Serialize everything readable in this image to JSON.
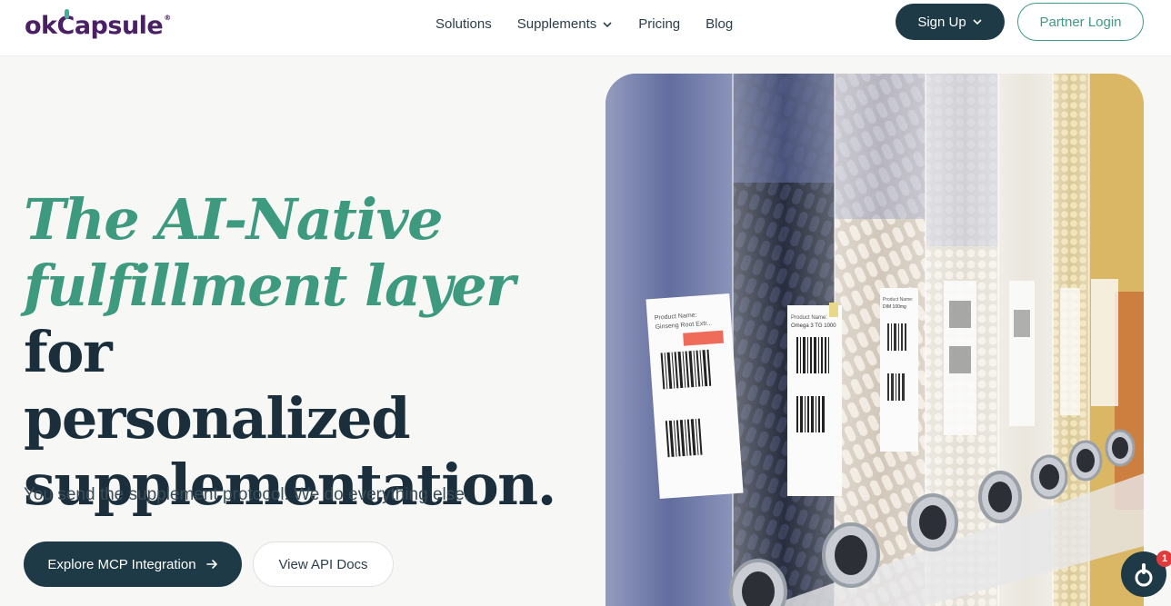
{
  "header": {
    "logo_text": "okCapsule",
    "logo_reg": "®",
    "nav": [
      {
        "label": "Solutions"
      },
      {
        "label": "Supplements"
      },
      {
        "label": "Pricing"
      },
      {
        "label": "Blog"
      }
    ],
    "signup_label": "Sign Up",
    "partner_login_label": "Partner Login"
  },
  "hero": {
    "title_accent_1": "The AI-Native",
    "title_accent_2": "fulfillment layer",
    "title_plain_1": " for",
    "title_plain_2": "personalized",
    "title_plain_3": "supplementation.",
    "subtitle": "You send the supplement protocol. We do everything else.",
    "primary_cta": "Explore MCP Integration",
    "primary_cta_icon": "arrow-right-icon",
    "secondary_cta": "View API Docs"
  },
  "image": {
    "labels": [
      {
        "name": "Product Name:",
        "value": "Ginseng Root Extr..."
      },
      {
        "name": "Product Name:",
        "value": "Omega 3 TG 1000"
      },
      {
        "name": "Product Name:",
        "value": "DIM 100mg"
      }
    ]
  },
  "chat": {
    "badge_count": "1",
    "icon": "chat-capsule-icon"
  },
  "colors": {
    "brand_dark": "#1d3a46",
    "accent_green": "#3d9a7f",
    "logo_purple": "#4a1f66"
  }
}
